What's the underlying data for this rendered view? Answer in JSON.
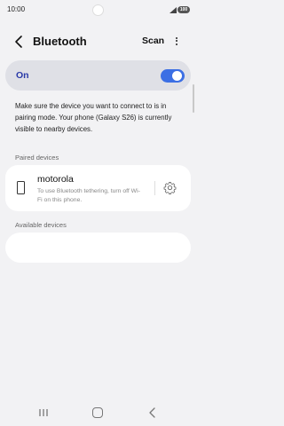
{
  "status": {
    "time": "10:00",
    "battery": "100"
  },
  "header": {
    "title": "Bluetooth",
    "scan_label": "Scan"
  },
  "toggle": {
    "label": "On",
    "state": true
  },
  "info_text": "Make sure the device you want to connect to is in pairing mode. Your phone (Galaxy S26) is currently visible to nearby devices.",
  "paired": {
    "section_label": "Paired devices",
    "devices": [
      {
        "name": "motorola",
        "description": "To use Bluetooth tethering, turn off Wi-Fi on this phone."
      }
    ]
  },
  "available": {
    "section_label": "Available devices"
  },
  "colors": {
    "accent": "#3c6fe4",
    "on_label": "#2a3aa8",
    "card_bg": "#dfe0e6",
    "page_bg": "#f2f2f4"
  },
  "icons": [
    "back-icon",
    "more-icon",
    "phone-icon",
    "gear-icon",
    "signal-icon",
    "battery-icon",
    "nav-recent-icon",
    "nav-home-icon",
    "nav-back-icon"
  ]
}
